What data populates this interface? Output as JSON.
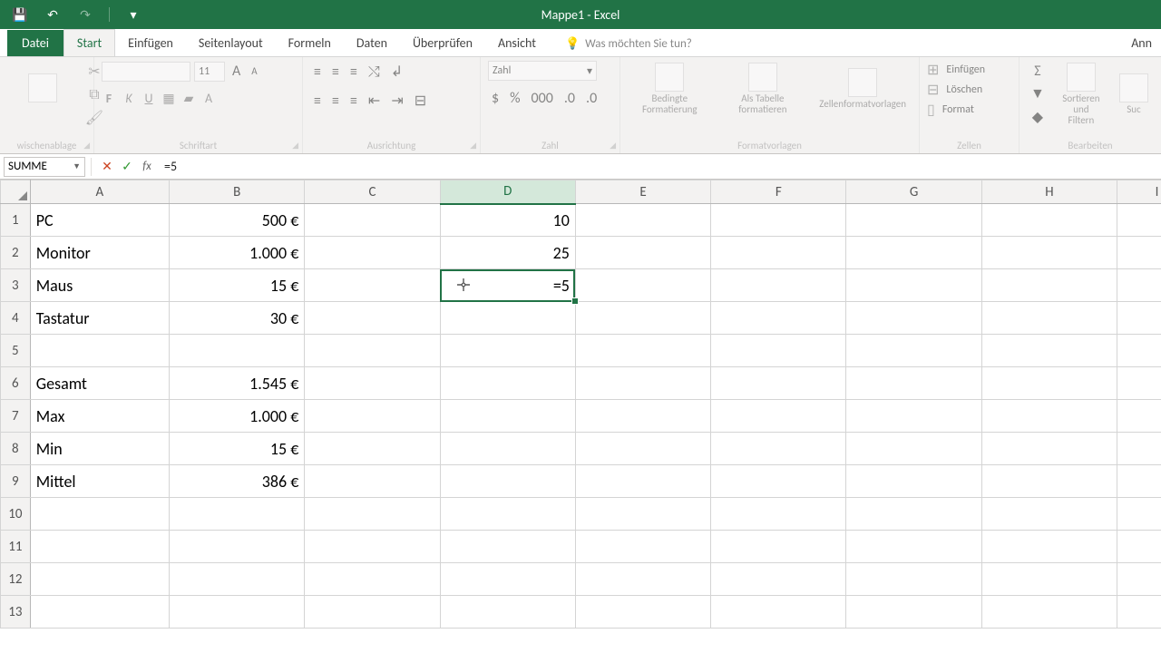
{
  "app_title": "Mappe1 - Excel",
  "qat": {
    "save": "save-icon",
    "undo": "↶",
    "redo": "↷",
    "customize": "▾"
  },
  "tabs": {
    "file": "Datei",
    "items": [
      "Start",
      "Einfügen",
      "Seitenlayout",
      "Formeln",
      "Daten",
      "Überprüfen",
      "Ansicht"
    ],
    "active": 0,
    "tell_me": "Was möchten Sie tun?",
    "right": "Ann"
  },
  "ribbon": {
    "clipboard": {
      "label": "wischenablage"
    },
    "font": {
      "label": "Schriftart",
      "name": "",
      "size": "11"
    },
    "alignment": {
      "label": "Ausrichtung"
    },
    "number": {
      "label": "Zahl",
      "format": "Zahl"
    },
    "styles": {
      "label": "Formatvorlagen",
      "conditional": "Bedingte Formatierung",
      "astable": "Als Tabelle formatieren",
      "cellstyles": "Zellenformatvorlagen"
    },
    "cells": {
      "label": "Zellen",
      "insert": "Einfügen",
      "delete": "Löschen",
      "format": "Format"
    },
    "editing": {
      "label": "Bearbeiten",
      "sortfilter": "Sortieren und Filtern",
      "find": "Suc"
    }
  },
  "formula_bar": {
    "name": "SUMME",
    "formula": "=5"
  },
  "columns": [
    "A",
    "B",
    "C",
    "D",
    "E",
    "F",
    "G",
    "H",
    "I"
  ],
  "active_col_index": 3,
  "active_cell": "D3",
  "rows": [
    "1",
    "2",
    "3",
    "4",
    "5",
    "6",
    "7",
    "8",
    "9",
    "10",
    "11",
    "12",
    "13"
  ],
  "cells": {
    "A1": "PC",
    "B1": "500 €",
    "D1": "10",
    "A2": "Monitor",
    "B2": "1.000 €",
    "D2": "25",
    "A3": "Maus",
    "B3": "15 €",
    "D3": "=5",
    "A4": "Tastatur",
    "B4": "30 €",
    "A6": "Gesamt",
    "B6": "1.545 €",
    "A7": "Max",
    "B7": "1.000 €",
    "A8": "Min",
    "B8": "15 €",
    "A9": "Mittel",
    "B9": "386 €"
  },
  "chart_data": {
    "type": "table",
    "items": [
      {
        "label": "PC",
        "value": 500,
        "currency": "€"
      },
      {
        "label": "Monitor",
        "value": 1000,
        "currency": "€"
      },
      {
        "label": "Maus",
        "value": 15,
        "currency": "€"
      },
      {
        "label": "Tastatur",
        "value": 30,
        "currency": "€"
      }
    ],
    "aggregates": {
      "Gesamt": 1545,
      "Max": 1000,
      "Min": 15,
      "Mittel": 386
    },
    "column_D": {
      "1": 10,
      "2": 25,
      "3_editing": "=5"
    }
  }
}
